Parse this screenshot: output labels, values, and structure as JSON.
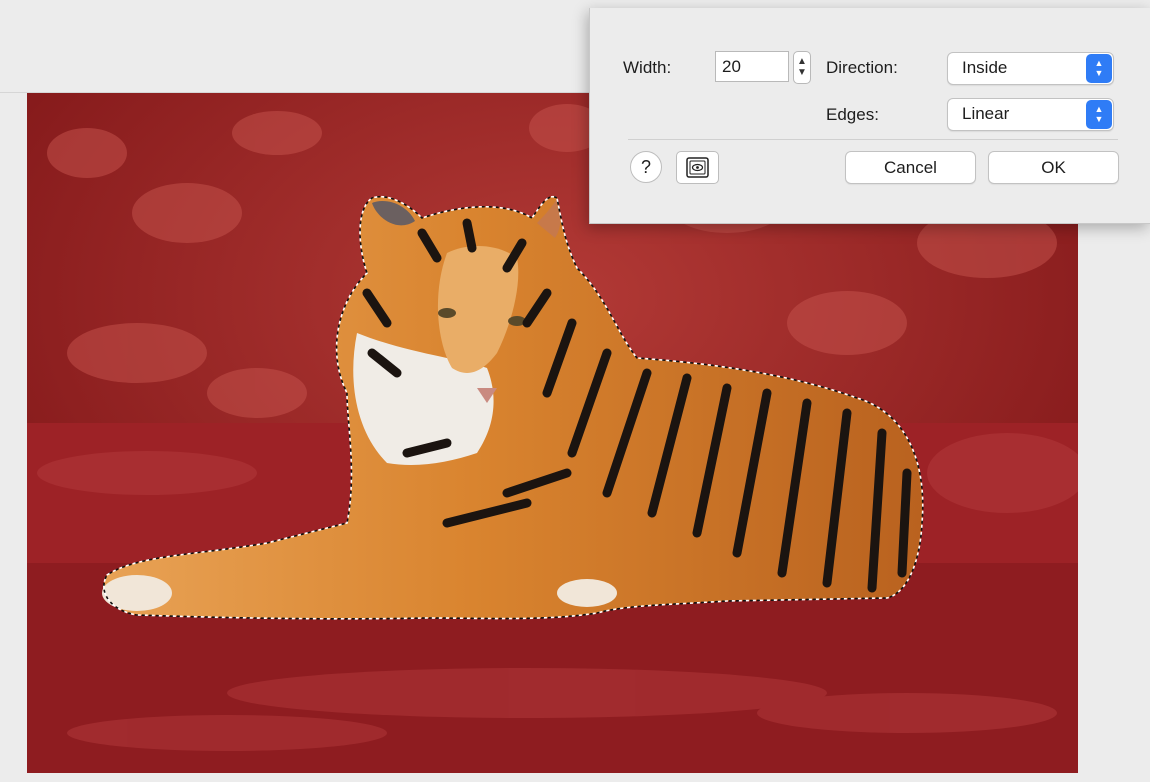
{
  "dialog": {
    "width_label": "Width:",
    "width_value": "20",
    "direction_label": "Direction:",
    "direction_value": "Inside",
    "edges_label": "Edges:",
    "edges_value": "Linear",
    "help_label": "?",
    "cancel_label": "Cancel",
    "ok_label": "OK"
  },
  "icons": {
    "stepper": "stepper-arrows-icon",
    "popup_chevron": "chevron-updown-icon",
    "preview": "preview-eye-icon",
    "help": "help-icon"
  },
  "colors": {
    "mask_overlay": "#8b1a1c",
    "accent": "#2f7cf6",
    "dialog_bg": "#ececec"
  }
}
